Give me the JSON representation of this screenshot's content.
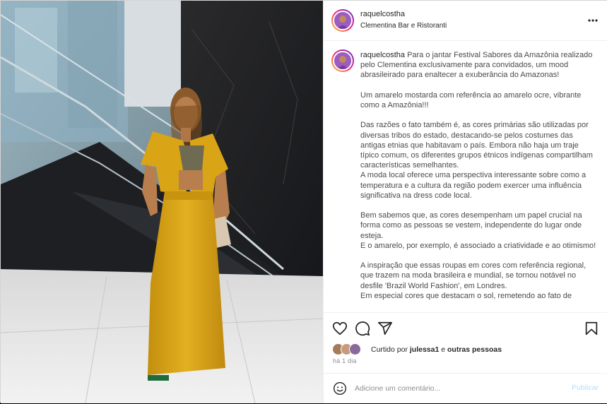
{
  "header": {
    "username": "raquelcostha",
    "location": "Clementina Bar e Ristoranti"
  },
  "caption": {
    "username": "raquelcostha",
    "text": "Para o jantar Festival Sabores da Amazônia realizado pelo Clementina exclusivamente para convidados, um mood abrasileirado para enaltecer a exuberância do Amazonas!\n\nUm amarelo mostarda com referência ao amarelo ocre, vibrante como a Amazônia!!!\n\nDas razões o fato também é, as cores primárias são utilizadas por diversas tribos do estado, destacando-se pelos costumes das antigas etnias que habitavam o país. Embora não haja um traje típico comum, os diferentes grupos étnicos indígenas compartilham características semelhantes.\nA moda local oferece uma perspectiva interessante sobre como a temperatura e a cultura da região podem exercer uma influência significativa na dress code local.\n\nBem sabemos que, as cores desempenham um papel crucial na forma como as pessoas se vestem, independente do lugar onde esteja.\nE o amarelo, por exemplo, é associado a criatividade e ao otimismo!\n\nA inspiração que essas roupas em cores com referência regional, que trazem na moda brasileira e mundial, se tornou notável no desfile 'Brazil World Fashion', em Londres.\nEm especial cores que destacam o sol, remetendo ao fato de"
  },
  "likes": {
    "prefix": "Curtido por ",
    "user": "julessa1",
    "middle": " e ",
    "others": "outras pessoas"
  },
  "timestamp": "há 1 dia",
  "comment": {
    "placeholder": "Adicione um comentário...",
    "publish_label": "Publicar"
  },
  "icons": {
    "more": "more-options-icon",
    "like": "heart-icon",
    "comment": "comment-icon",
    "share": "share-icon",
    "save": "bookmark-icon",
    "emoji": "emoji-icon"
  },
  "colors": {
    "dress": "#d9a516",
    "publish_disabled": "#b2dffc",
    "secondary_text": "#8e8e8e"
  }
}
